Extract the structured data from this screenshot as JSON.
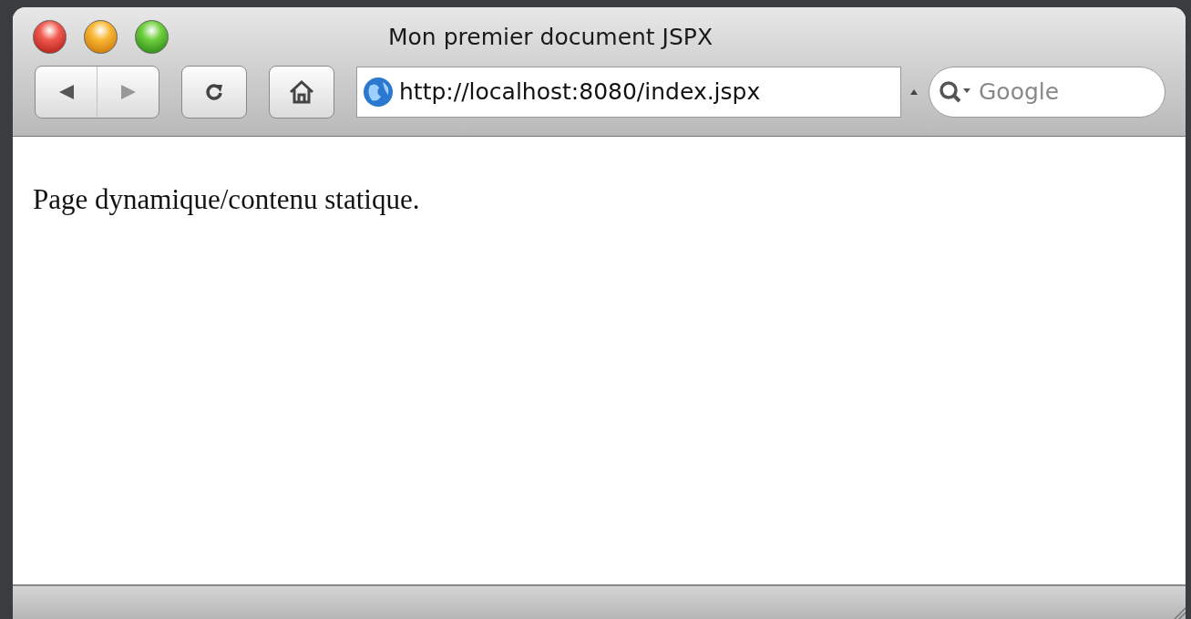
{
  "window": {
    "title": "Mon premier document JSPX"
  },
  "toolbar": {
    "url": "http://localhost:8080/index.jspx",
    "search": {
      "placeholder": "Google"
    }
  },
  "page": {
    "paragraph": "Page dynamique/contenu statique."
  }
}
